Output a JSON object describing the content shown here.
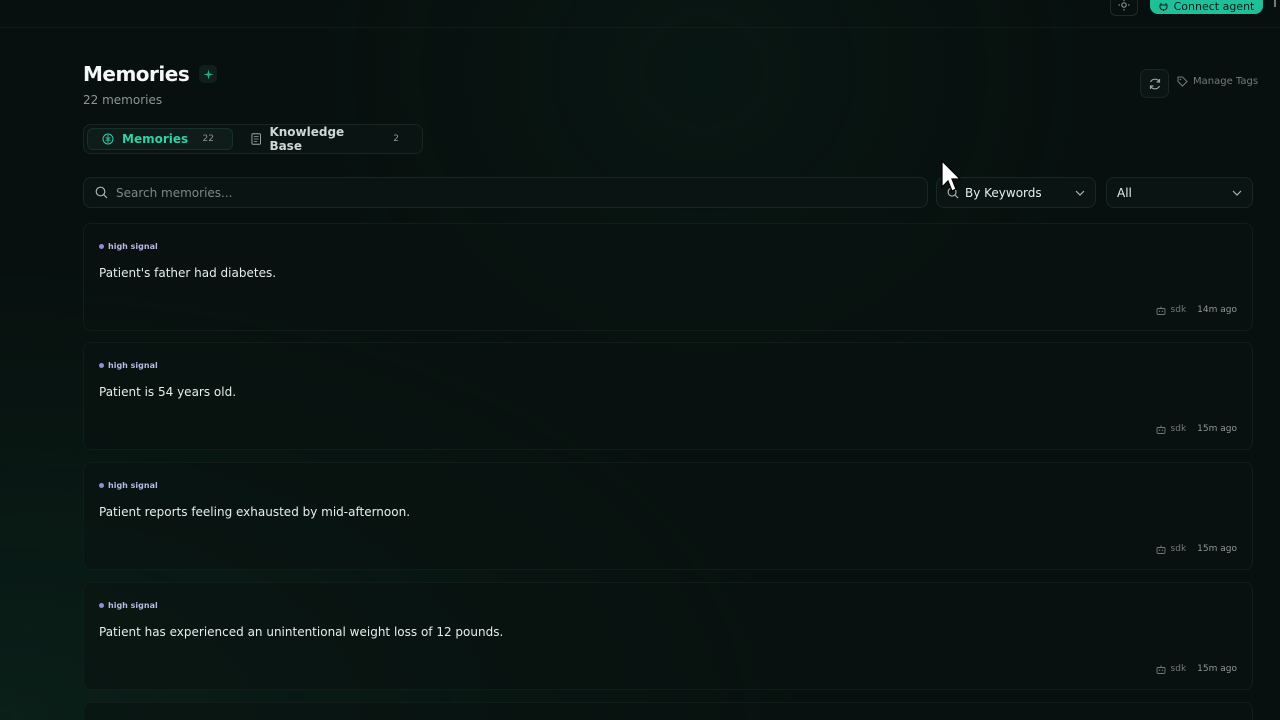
{
  "header": {
    "connect_label": "Connect agent",
    "theme_icon": "sun-icon"
  },
  "page": {
    "title": "Memories",
    "count_label": "22 memories",
    "manage_tags_label": "Manage Tags"
  },
  "tabs": [
    {
      "label": "Memories",
      "count": "22",
      "icon": "brain-icon"
    },
    {
      "label": "Knowledge Base",
      "count": "2",
      "icon": "document-icon"
    }
  ],
  "search": {
    "placeholder": "Search memories..."
  },
  "filters": {
    "mode": "By Keywords",
    "scope": "All"
  },
  "memories": [
    {
      "badge": "high signal",
      "text": "Patient's father had diabetes.",
      "source": "sdk",
      "time": "14m ago"
    },
    {
      "badge": "high signal",
      "text": "Patient is 54 years old.",
      "source": "sdk",
      "time": "15m ago"
    },
    {
      "badge": "high signal",
      "text": "Patient reports feeling exhausted by mid-afternoon.",
      "source": "sdk",
      "time": "15m ago"
    },
    {
      "badge": "high signal",
      "text": "Patient has experienced an unintentional weight loss of 12 pounds.",
      "source": "sdk",
      "time": "15m ago"
    }
  ],
  "colors": {
    "accent": "#2fd1a7",
    "connect_button": "#1fbf9a",
    "badge_dot": "#8b8fd6",
    "background": "#07100e"
  }
}
